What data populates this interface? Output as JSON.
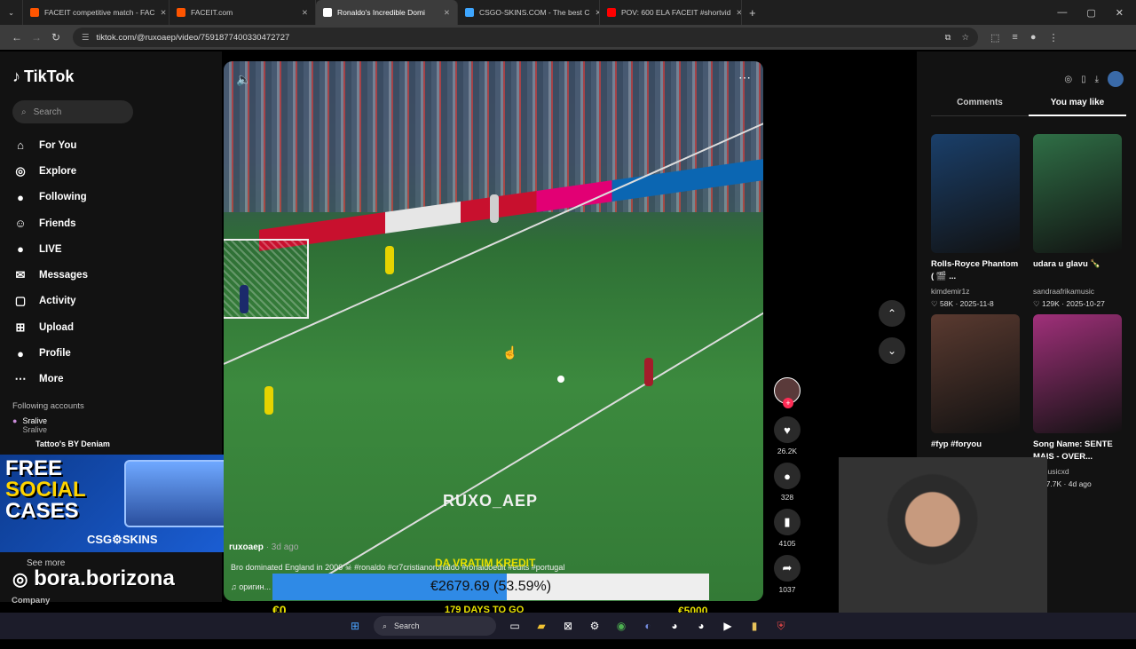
{
  "browser": {
    "tabs": [
      {
        "label": "FACEIT competitive match - FAC",
        "color": "#ff5500",
        "active": false
      },
      {
        "label": "FACEIT.com",
        "color": "#ff5500",
        "active": false
      },
      {
        "label": "Ronaldo's Incredible Domi",
        "color": "#ffffff",
        "active": true
      },
      {
        "label": "CSGO-SKINS.COM - The best C",
        "color": "#3ea6ff",
        "active": false
      },
      {
        "label": "POV: 600 ELA FACEIT #shortvid",
        "color": "#ff0000",
        "active": false
      }
    ],
    "new_tab": "+",
    "url": "tiktok.com/@ruxoaep/video/7591877400330472727"
  },
  "sidebar": {
    "logo": "TikTok",
    "search_placeholder": "Search",
    "items": [
      {
        "label": "For You",
        "icon": "⌂"
      },
      {
        "label": "Explore",
        "icon": "◎"
      },
      {
        "label": "Following",
        "icon": "●"
      },
      {
        "label": "Friends",
        "icon": "☺"
      },
      {
        "label": "LIVE",
        "icon": "●"
      },
      {
        "label": "Messages",
        "icon": "✉"
      },
      {
        "label": "Activity",
        "icon": "▢"
      },
      {
        "label": "Upload",
        "icon": "⊞"
      },
      {
        "label": "Profile",
        "icon": "●"
      },
      {
        "label": "More",
        "icon": "⋯"
      }
    ],
    "following_title": "Following accounts",
    "accounts": [
      {
        "name": "Sralive",
        "sub": "Sralive"
      },
      {
        "name": "Tattoo's BY Deniam",
        "sub": ""
      }
    ],
    "see_more": "See more",
    "company": "Company"
  },
  "promo": {
    "line1": "FREE",
    "line2": "SOCIAL",
    "line3": "CASES",
    "brand": "CSG⚙SKINS",
    "handle": "bora.borizona"
  },
  "video": {
    "watermark": "RUXO_AEP",
    "author": "ruxoaep",
    "date": "· 3d ago",
    "caption": "Bro dominated England in 2006 ☠ #ronaldo #cr7cristianoronaldo #ronaldoedit #edits #portugal",
    "music": "♫  оригин...",
    "overlay_text": "DA VRATIM KREDIT",
    "likes": "26.2K",
    "comments": "328",
    "saves": "4105",
    "shares": "1037"
  },
  "goal_bar": {
    "amount_text": "€2679.69 (53.59%)",
    "progress_percent": 53.59,
    "start": "€0",
    "end": "€5000",
    "days": "179 DAYS TO GO"
  },
  "right_panel": {
    "tab_comments": "Comments",
    "tab_you_may_like": "You may like",
    "cards": [
      {
        "title": "Rolls-Royce Phantom ( 🎬 ...",
        "user": "kimdemir1z",
        "meta": "♡ 58K · 2025-11-8",
        "color": "#1a3f6a"
      },
      {
        "title": "udara u glavu 🍾",
        "user": "sandraafrikamusic",
        "meta": "♡ 129K · 2025-10-27",
        "color": "#2f6f46"
      },
      {
        "title": "#fyp #foryou",
        "user": "",
        "meta": "",
        "color": "#5a3a30"
      },
      {
        "title": "Song Name: SENTE MAIS - OVER...",
        "user": "anmusicxd",
        "meta": "♡ 17.7K · 4d ago",
        "color": "#a0307a"
      },
      {
        "title": "",
        "user": "",
        "meta": "",
        "color": "#8a9aa8"
      }
    ]
  },
  "taskbar": {
    "search_label": "Search"
  }
}
